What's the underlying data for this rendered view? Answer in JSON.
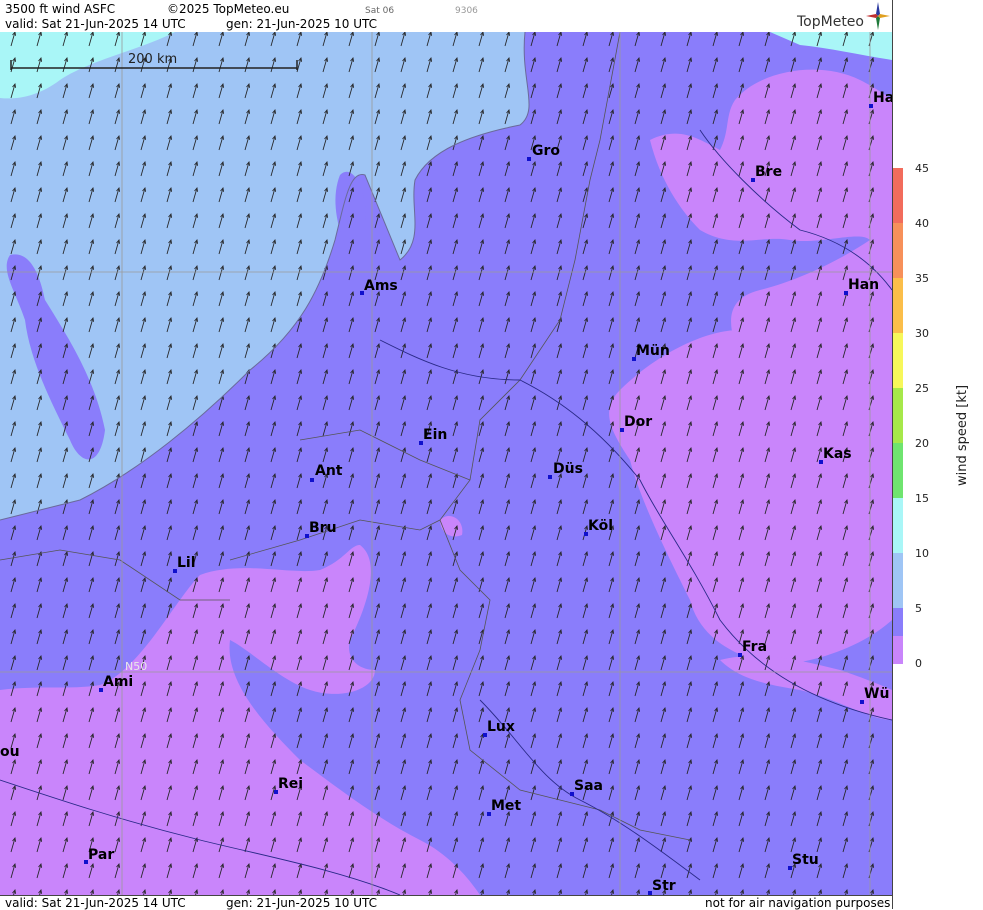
{
  "header": {
    "title": "3500 ft wind ASFC",
    "copyright": "©2025 TopMeteo.eu",
    "valid_line": "valid:  Sat  21-Jun-2025  14 UTC",
    "gen_line": "gen: 21-Jun-2025 10 UTC",
    "small_code_1": "Sat 06",
    "small_code_2": "9306",
    "brand": "TopMeteo"
  },
  "footer": {
    "valid_line": "valid:  Sat  21-Jun-2025  14 UTC",
    "gen_line": "gen: 21-Jun-2025 10 UTC",
    "disclaimer": "not for air navigation purposes"
  },
  "map": {
    "scale_bar_label": "200 km",
    "latitude_label": "N50",
    "cities": [
      {
        "name": "Gro"
      },
      {
        "name": "Bre"
      },
      {
        "name": "Ha"
      },
      {
        "name": "Ams"
      },
      {
        "name": "Han"
      },
      {
        "name": "Mün"
      },
      {
        "name": "Dor"
      },
      {
        "name": "Ein"
      },
      {
        "name": "Kas"
      },
      {
        "name": "Ant"
      },
      {
        "name": "Düs"
      },
      {
        "name": "Bru"
      },
      {
        "name": "Köl"
      },
      {
        "name": "Lil"
      },
      {
        "name": "Fra"
      },
      {
        "name": "Ami"
      },
      {
        "name": "Wü"
      },
      {
        "name": "Lux"
      },
      {
        "name": "ou"
      },
      {
        "name": "Rei"
      },
      {
        "name": "Saa"
      },
      {
        "name": "Met"
      },
      {
        "name": "Par"
      },
      {
        "name": "Stu"
      },
      {
        "name": "Str"
      }
    ]
  },
  "legend": {
    "title": "wind speed  [kt]",
    "unit": "kt",
    "ticks": [
      "45",
      "40",
      "35",
      "30",
      "25",
      "20",
      "15",
      "10",
      "5",
      "0"
    ],
    "colors": [
      "#c985fb",
      "#8a7dfb",
      "#9fc5f5",
      "#a9f6f7",
      "#6fe46f",
      "#a6e84a",
      "#f7f75a",
      "#fbbe4a",
      "#f7905a",
      "#f26c5c"
    ]
  }
}
